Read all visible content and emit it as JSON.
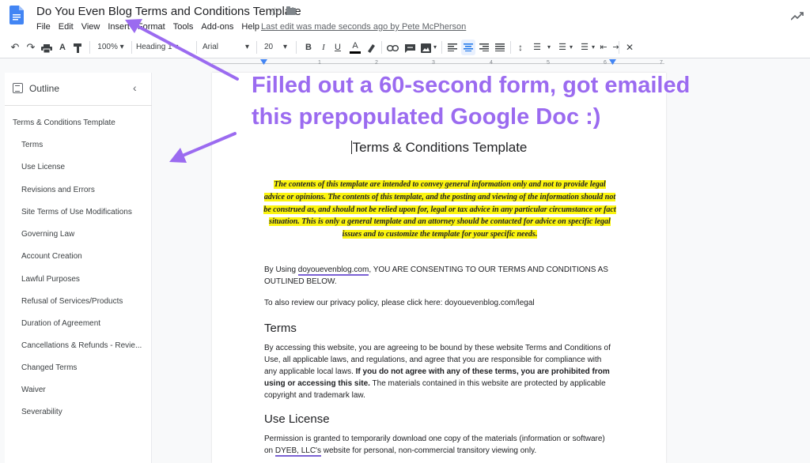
{
  "window": {
    "title": "Do You Even Blog Terms and Conditions Template",
    "last_edit": "Last edit was made seconds ago by Pete McPherson"
  },
  "menu": [
    "File",
    "Edit",
    "View",
    "Insert",
    "Format",
    "Tools",
    "Add-ons",
    "Help"
  ],
  "toolbar": {
    "zoom": "100%",
    "style": "Heading 1",
    "font": "Arial",
    "font_size": "20"
  },
  "ruler": [
    "1",
    "2",
    "3",
    "4",
    "5",
    "6",
    "7"
  ],
  "outline": {
    "title": "Outline",
    "heading": "Terms & Conditions Template",
    "items": [
      "Terms",
      "Use License",
      "Revisions and Errors",
      "Site Terms of Use Modifications",
      "Governing Law",
      "Account Creation",
      "Lawful Purposes",
      "Refusal of Services/Products",
      "Duration of Agreement",
      "Cancellations & Refunds - Revie...",
      "Changed Terms",
      "Waiver",
      "Severability"
    ]
  },
  "document": {
    "title": "Terms & Conditions Template",
    "disclaimer": "The contents of this template are intended to convey general information only and not to provide legal advice or opinions. The contents of this template, and the posting and viewing of the information should not be construed as, and should not be relied upon for, legal or tax advice in any particular circumstance or fact situation.  This is only a general template and an attorney should be contacted for advice on specific legal issues and to customize the template for your specific needs.",
    "consent_prefix": "By Using ",
    "consent_site": "doyouevenblog.com",
    "consent_suffix": ", YOU ARE CONSENTING TO OUR TERMS AND CONDITIONS AS OUTLINED BELOW.",
    "privacy": "To also review our privacy policy, please click here: doyouevenblog.com/legal",
    "terms_heading": "Terms",
    "terms_text": "By accessing this website, you are agreeing to be bound by these website Terms and Conditions of Use, all applicable laws, and regulations, and agree that you are responsible for compliance with any applicable local laws. ",
    "terms_bold": "If you do not agree with any of these terms, you are prohibited from using or accessing this site.",
    "terms_tail": " The materials contained in this website are protected by applicable copyright and trademark law.",
    "license_heading": "Use License",
    "license_prefix": "Permission is granted to temporarily download one copy of the materials (information or software) on ",
    "license_company": "DYEB, LLC's",
    "license_suffix": " website for personal, non-commercial transitory viewing only."
  },
  "annotation": {
    "line1": "Filled out a 60-second form, got emailed",
    "line2": "this prepopulated Google Doc :)"
  },
  "colors": {
    "annotation": "#9b6bf0",
    "highlight": "#fbf40e",
    "docs_blue": "#4285f4"
  }
}
